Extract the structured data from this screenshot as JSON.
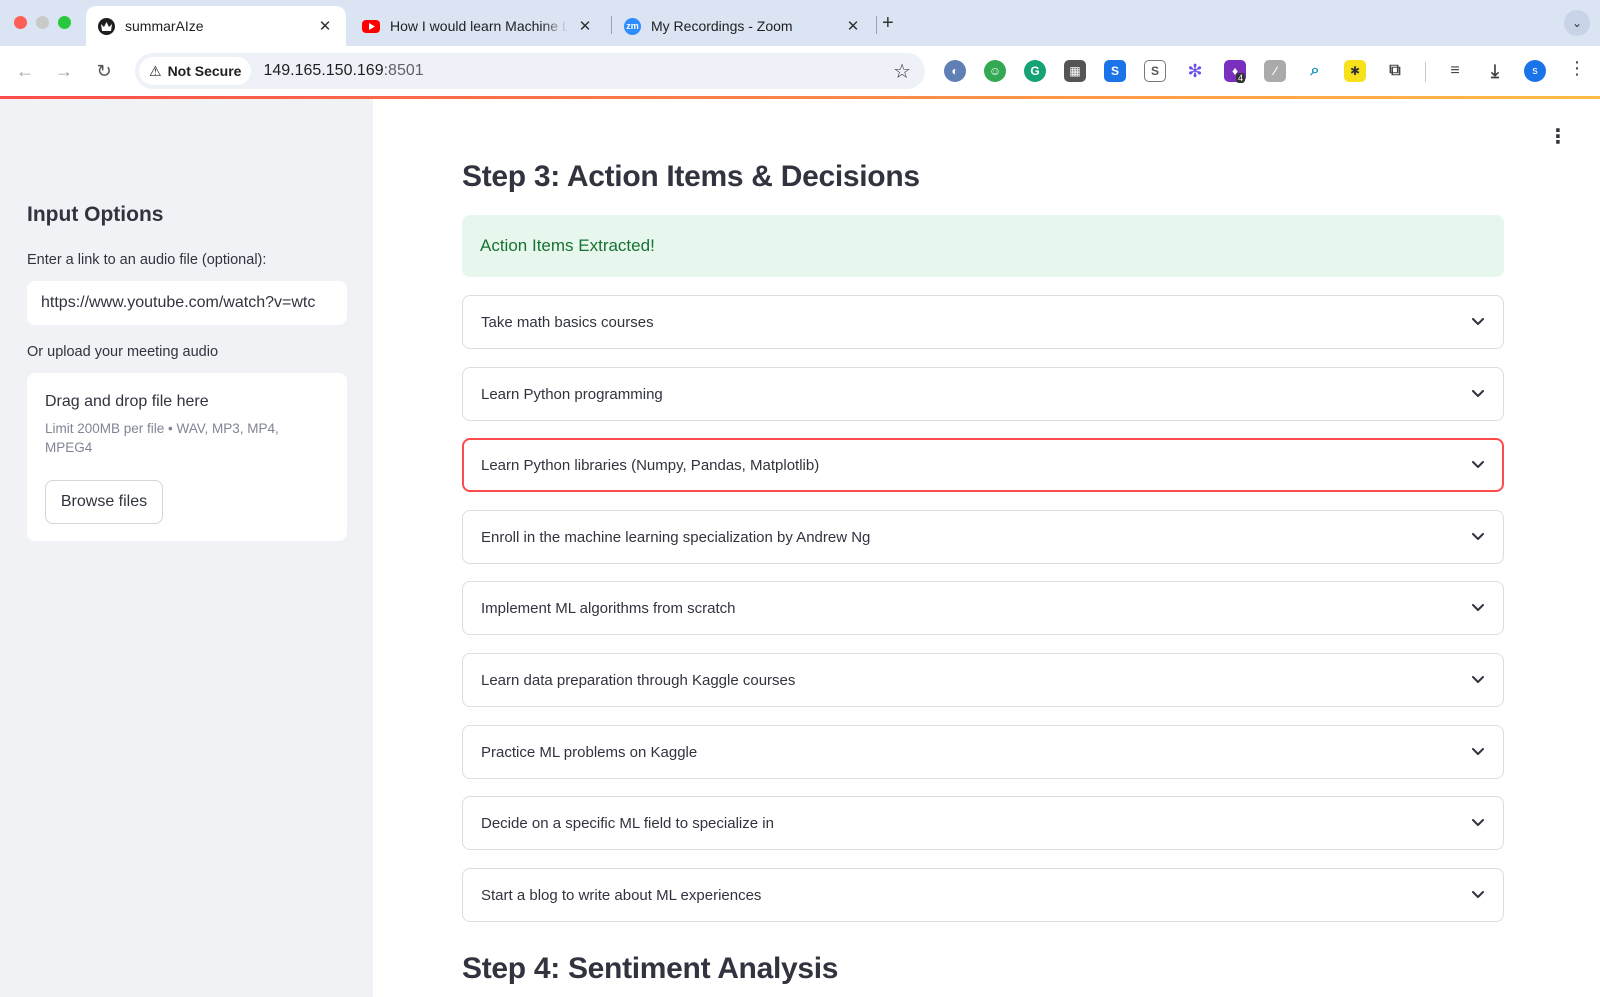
{
  "browser": {
    "tabs": [
      {
        "title": "summarAIze",
        "active": true
      },
      {
        "title": "How I would learn Machine Le",
        "active": false
      },
      {
        "title": "My Recordings - Zoom",
        "active": false
      }
    ],
    "zoom_favicon_text": "zm",
    "security_label": "Not Secure",
    "url_host": "149.165.150.169",
    "url_port": ":8501",
    "extension_badge": "4",
    "profile_initial": "s",
    "colors": {
      "accent": "#ff4b4b",
      "youtube": "#ff0000",
      "zoom": "#2d8cff"
    }
  },
  "sidebar": {
    "heading": "Input Options",
    "link_label": "Enter a link to an audio file (optional):",
    "link_value": "https://www.youtube.com/watch?v=wtc",
    "upload_label": "Or upload your meeting audio",
    "dropzone_title": "Drag and drop file here",
    "dropzone_limit": "Limit 200MB per file • WAV, MP3, MP4, MPEG4",
    "browse_label": "Browse files"
  },
  "main": {
    "step3_title": "Step 3: Action Items & Decisions",
    "success_message": "Action Items Extracted!",
    "action_items": [
      "Take math basics courses",
      "Learn Python programming",
      "Learn Python libraries (Numpy, Pandas, Matplotlib)",
      "Enroll in the machine learning specialization by Andrew Ng",
      "Implement ML algorithms from scratch",
      "Learn data preparation through Kaggle courses",
      "Practice ML problems on Kaggle",
      "Decide on a specific ML field to specialize in",
      "Start a blog to write about ML experiences"
    ],
    "step4_title": "Step 4: Sentiment Analysis"
  }
}
